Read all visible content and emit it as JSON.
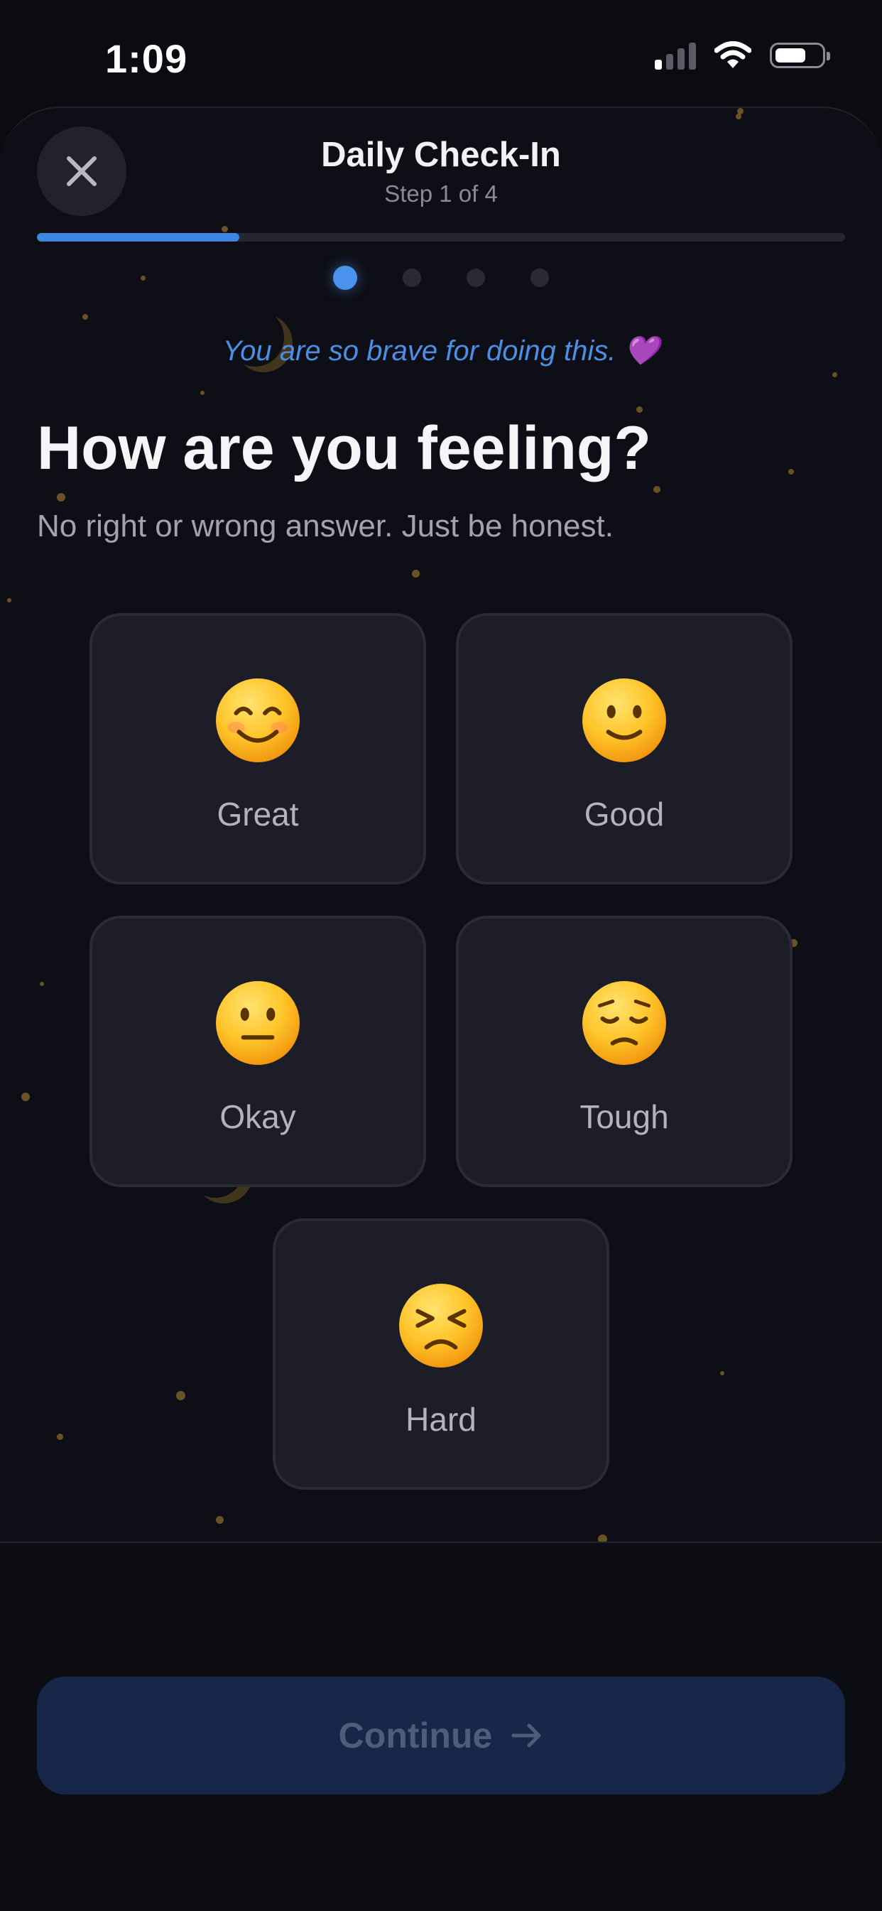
{
  "status_bar": {
    "time": "1:09"
  },
  "header": {
    "title": "Daily Check-In",
    "subtitle": "Step 1 of 4"
  },
  "progress": {
    "current_step": 1,
    "total_steps": 4,
    "fraction": 0.25
  },
  "encouragement": "You are so brave for doing this. 💜",
  "question": {
    "title": "How are you feeling?",
    "subtitle": "No right or wrong answer. Just be honest."
  },
  "moods": [
    {
      "label": "Great",
      "icon": "smiling-face-with-smiling-eyes-icon"
    },
    {
      "label": "Good",
      "icon": "slightly-smiling-face-icon"
    },
    {
      "label": "Okay",
      "icon": "neutral-face-icon"
    },
    {
      "label": "Tough",
      "icon": "pensive-face-icon"
    },
    {
      "label": "Hard",
      "icon": "persevering-face-icon"
    }
  ],
  "continue_button": {
    "label": "Continue"
  },
  "colors": {
    "accent": "#3f86e0",
    "background": "#0e0e16",
    "card": "#1d1d28",
    "button_disabled": "#162749"
  }
}
